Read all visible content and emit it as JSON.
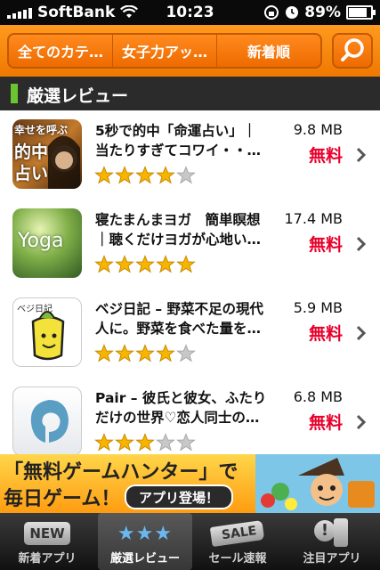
{
  "status": {
    "carrier": "SoftBank",
    "time": "10:23",
    "battery": "89%",
    "battery_level": 0.89
  },
  "filters": {
    "category": "全てのカテ…",
    "subcategory": "女子力アッ…",
    "sort": "新着順",
    "search_icon": "search-icon"
  },
  "section": {
    "title": "厳選レビュー",
    "accent_color": "#6bc431"
  },
  "apps": [
    {
      "title_line1": "5秒で的中「命運占い」｜",
      "title_line2": "当たりすぎてコワイ・・…",
      "size": "9.8 MB",
      "price": "無料",
      "rating": 4,
      "thumb_text": [
        "幸せを呼ぶ",
        "的中",
        "占い"
      ]
    },
    {
      "title_line1": "寝たまんまヨガ　簡単瞑想",
      "title_line2": "｜聴くだけヨガが心地い…",
      "size": "17.4 MB",
      "price": "無料",
      "rating": 5,
      "thumb_text": [
        "Yoga"
      ]
    },
    {
      "title_line1": "ベジ日記 – 野菜不足の現代",
      "title_line2": "人に。野菜を食べた量を…",
      "size": "5.9 MB",
      "price": "無料",
      "rating": 4,
      "thumb_text": [
        "ベジ日記"
      ]
    },
    {
      "title_line1": "Pair – 彼氏と彼女、ふたり",
      "title_line2": "だけの世界♡恋人同士の…",
      "size": "6.8 MB",
      "price": "無料",
      "rating": 3,
      "thumb_text": []
    }
  ],
  "banner": {
    "line1": "「無料ゲームハンター」で",
    "line2": "毎日ゲーム！",
    "badge": "アプリ登場！"
  },
  "tabs": [
    {
      "label": "新着アプリ",
      "icon_text": "NEW",
      "icon": "new-icon",
      "active": false
    },
    {
      "label": "厳選レビュー",
      "icon_text": "★★★",
      "icon": "stars-icon",
      "active": true
    },
    {
      "label": "セール速報",
      "icon_text": "SALE",
      "icon": "sale-tag-icon",
      "active": false
    },
    {
      "label": "注目アプリ",
      "icon_text": "!",
      "icon": "phone-alert-icon",
      "active": false
    }
  ],
  "colors": {
    "orange": "#f07800",
    "price_red": "#e8002c",
    "star_gold": "#f7b500",
    "star_gray": "#c8c8c8"
  }
}
